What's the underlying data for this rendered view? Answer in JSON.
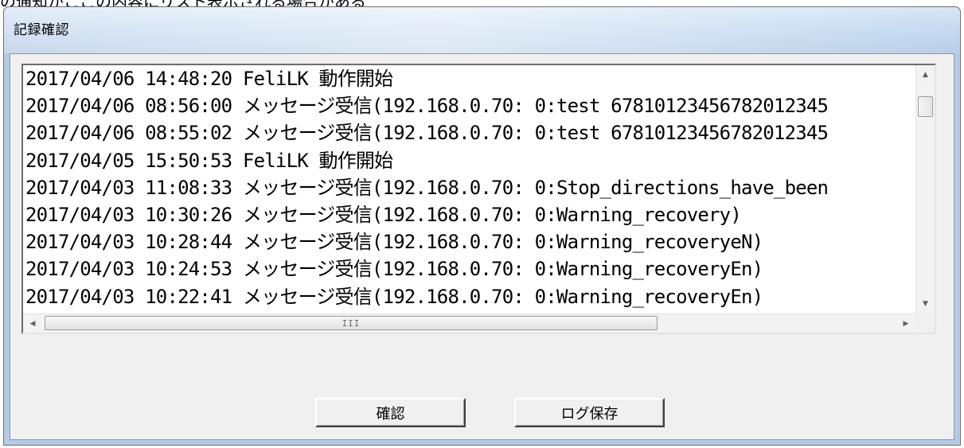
{
  "top_text": "の通知がここの内容にリスト表示される場合がある",
  "window": {
    "title": "記録確認"
  },
  "log_lines": [
    "2017/04/06 14:48:20 FeliLK 動作開始",
    "2017/04/06 08:56:00 メッセージ受信(192.168.0.70: 0:test 67810123456782012345",
    "2017/04/06 08:55:02 メッセージ受信(192.168.0.70: 0:test 67810123456782012345",
    "2017/04/05 15:50:53 FeliLK 動作開始",
    "2017/04/03 11:08:33 メッセージ受信(192.168.0.70: 0:Stop_directions_have_been",
    "2017/04/03 10:30:26 メッセージ受信(192.168.0.70: 0:Warning_recovery)",
    "2017/04/03 10:28:44 メッセージ受信(192.168.0.70: 0:Warning_recoveryeN)",
    "2017/04/03 10:24:53 メッセージ受信(192.168.0.70: 0:Warning_recoveryEn)",
    "2017/04/03 10:22:41 メッセージ受信(192.168.0.70: 0:Warning_recoveryEn)"
  ],
  "scrollbars": {
    "vertical": {
      "up_icon": "▲",
      "down_icon": "▼"
    },
    "horizontal": {
      "left_icon": "◀",
      "right_icon": "▶",
      "grip": "III"
    }
  },
  "buttons": {
    "confirm_label": "確認",
    "save_log_label": "ログ保存"
  }
}
